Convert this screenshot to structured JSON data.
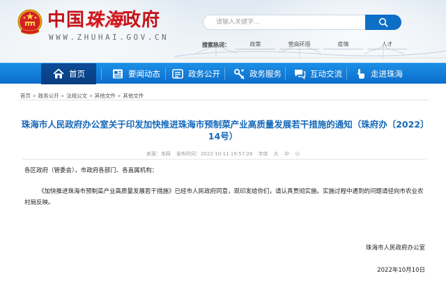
{
  "header": {
    "site_name_a": "中国",
    "site_name_b": "珠海",
    "site_name_c": "政府",
    "url": "WWW.ZHUHAI.GOV.CN"
  },
  "search": {
    "placeholder": "请输入关键字...",
    "hot_label": "搜索热词：",
    "hot_words": [
      "政策",
      "营商环境",
      "疫情",
      "人才"
    ]
  },
  "nav": {
    "items": [
      "首页",
      "要闻动态",
      "政务公开",
      "政务服务",
      "互动交流",
      "走进珠海"
    ],
    "active": "首页"
  },
  "breadcrumb": [
    "首页",
    "政务公开",
    "法规公文",
    "其他文件",
    "其他文件"
  ],
  "article": {
    "title": "珠海市人民政府办公室关于印发加快推进珠海市预制菜产业高质量发展若干措施的通知（珠府办〔2022〕14号）",
    "meta": {
      "source_label": "来源：",
      "source_value": "本网",
      "time_label": "发布时间：",
      "time_value": "2022-10-11 19:57:28",
      "font_label": "字体",
      "sizes": [
        "大",
        "中",
        "小"
      ]
    },
    "salutation": "各区政府（管委会），市政府各部门、各直属机构：",
    "paragraph": "《加快推进珠海市预制菜产业高质量发展若干措施》已经市人民政府同意，现印发给你们，请认真贯彻实施。实施过程中遇到的问题请径向市农业农村局反映。",
    "signature": "珠海市人民政府办公室",
    "date": "2022年10月10日"
  },
  "colors": {
    "brand_red": "#c4141b",
    "nav_blue": "#0e6fc7",
    "nav_active": "#0a4a94",
    "title_blue": "#1468b8"
  },
  "icons": [
    "national-emblem-icon",
    "search-icon",
    "home-icon",
    "news-icon",
    "open-gov-icon",
    "service-icon",
    "chat-icon",
    "visit-icon"
  ]
}
